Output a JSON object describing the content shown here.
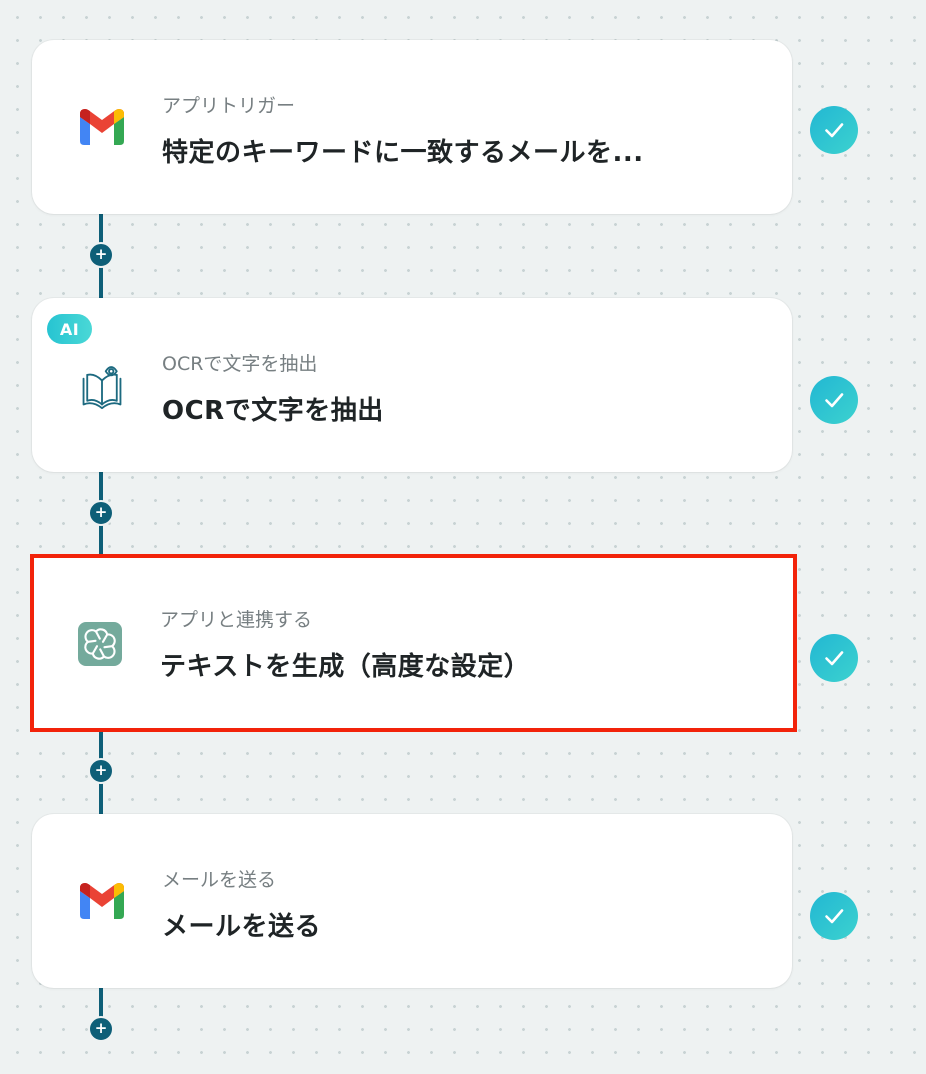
{
  "steps": [
    {
      "subtitle": "アプリトリガー",
      "title": "特定のキーワードに一致するメールを...",
      "icon": "gmail-icon"
    },
    {
      "subtitle": "OCRで文字を抽出",
      "title": "OCRで文字を抽出",
      "icon": "ocr-book-icon",
      "badge": "AI"
    },
    {
      "subtitle": "アプリと連携する",
      "title": "テキストを生成（高度な設定）",
      "icon": "chatgpt-icon"
    },
    {
      "subtitle": "メールを送る",
      "title": "メールを送る",
      "icon": "gmail-icon"
    }
  ],
  "colors": {
    "connector": "#0e5f78",
    "check_gradient_start": "#22b7d3",
    "check_gradient_end": "#3cd2cf",
    "selection_border": "#f2230a",
    "ai_badge": "#27c4d2"
  }
}
